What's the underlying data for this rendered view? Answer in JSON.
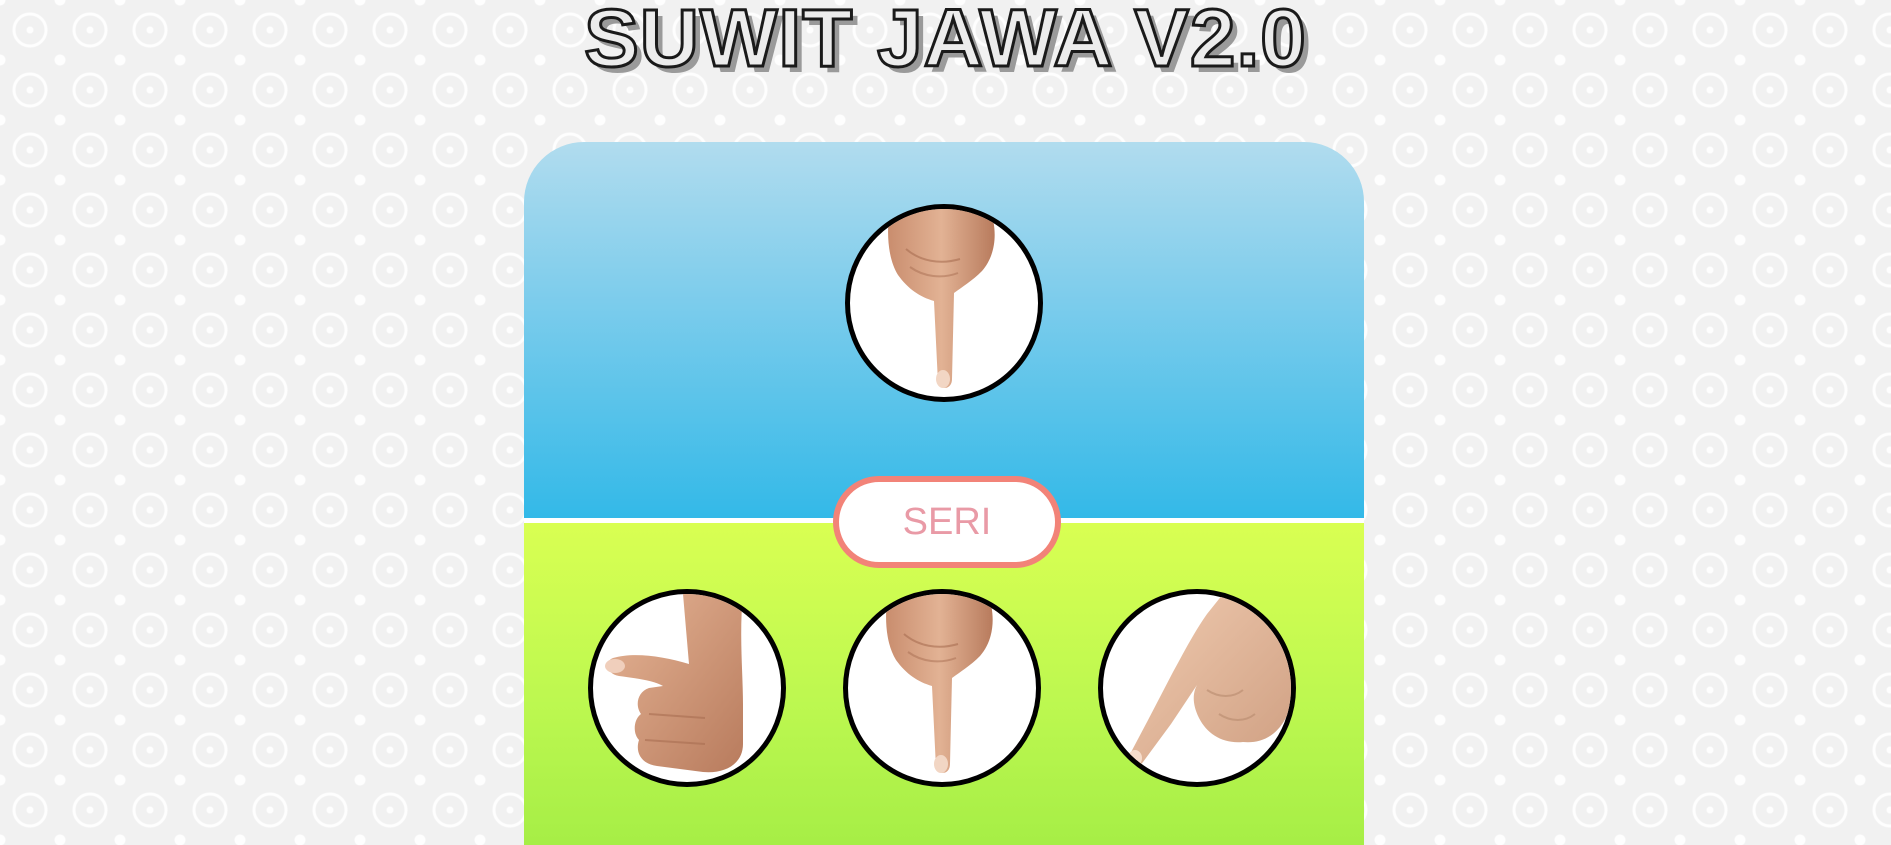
{
  "header": {
    "title": "SUWIT JAWA V2.0"
  },
  "computer": {
    "choice": "semut",
    "choice_icon": "pinky-finger-down-icon"
  },
  "result": {
    "label": "SERI"
  },
  "player": {
    "options": [
      {
        "id": "gajah",
        "icon": "thumb-up-fist-icon"
      },
      {
        "id": "semut",
        "icon": "pinky-finger-down-icon"
      },
      {
        "id": "orang",
        "icon": "index-finger-pointing-icon"
      }
    ]
  },
  "colors": {
    "cpu_zone_top": "#b1dcee",
    "cpu_zone_bottom": "#33b9e8",
    "player_zone_top": "#d9ff52",
    "player_zone_bottom": "#a6ee46",
    "result_border": "#f28378",
    "result_text": "#e99aa6",
    "skin": "#dba98a"
  }
}
